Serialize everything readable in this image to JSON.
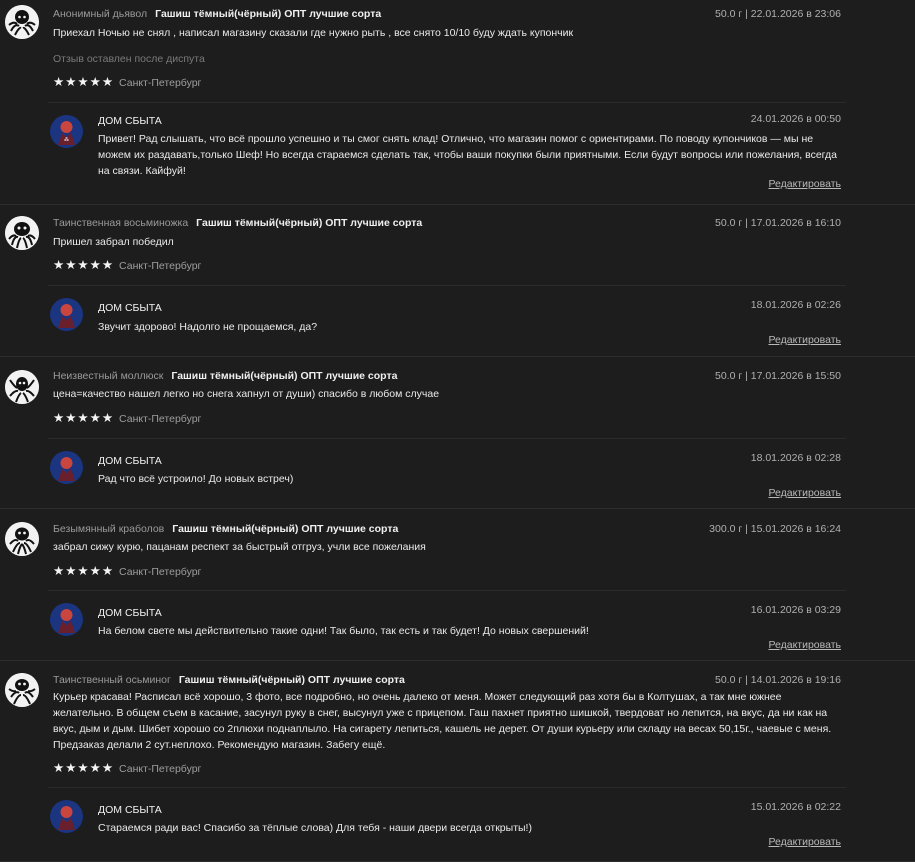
{
  "reviews": [
    {
      "author": "Анонимный дьявол",
      "product": "Гашиш тёмный(чёрный) ОПТ лучшие сорта",
      "meta": "50.0 г | 22.01.2026 в 23:06",
      "text": "Приехал Ночью не снял , написал магазину сказали где нужно рыть , все снято 10/10 буду ждать купончик",
      "note": "Отзыв оставлен после диспута",
      "stars": "★★★★★",
      "rating_value": 5,
      "city": "Санкт-Петербург",
      "reply": {
        "shop": "ДОМ СБЫТА",
        "date": "24.01.2026 в 00:50",
        "text": "Привет! Рад слышать, что всё прошло успешно и ты смог снять клад! Отлично, что магазин помог с ориентирами. По поводу купончиков — мы не можем их раздавать,только Шеф! Но всегда стараемся сделать так, чтобы ваши покупки были приятными. Если будут вопросы или пожелания, всегда на связи. Кайфуй!",
        "edit": "Редактировать"
      }
    },
    {
      "author": "Таинственная восьминожка",
      "product": "Гашиш тёмный(чёрный) ОПТ лучшие сорта",
      "meta": "50.0 г | 17.01.2026 в 16:10",
      "text": "Пришел забрал победил",
      "stars": "★★★★★",
      "rating_value": 5,
      "city": "Санкт-Петербург",
      "reply": {
        "shop": "ДОМ СБЫТА",
        "date": "18.01.2026 в 02:26",
        "text": "Звучит здорово! Надолго не прощаемся, да?",
        "edit": "Редактировать"
      }
    },
    {
      "author": "Неизвестный моллюск",
      "product": "Гашиш тёмный(чёрный) ОПТ лучшие сорта",
      "meta": "50.0 г | 17.01.2026 в 15:50",
      "text": "цена=качество нашел легко но снега хапнул от души) спасибо в любом случае",
      "stars": "★★★★★",
      "rating_value": 5,
      "city": "Санкт-Петербург",
      "reply": {
        "shop": "ДОМ СБЫТА",
        "date": "18.01.2026 в 02:28",
        "text": "Рад что всё устроило! До новых встреч)",
        "edit": "Редактировать"
      }
    },
    {
      "author": "Безымянный краболов",
      "product": "Гашиш тёмный(чёрный) ОПТ лучшие сорта",
      "meta": "300.0 г | 15.01.2026 в 16:24",
      "text": "забрал сижу курю, пацанам респект за быстрый отгруз, учли все пожелания",
      "stars": "★★★★★",
      "rating_value": 5,
      "city": "Санкт-Петербург",
      "reply": {
        "shop": "ДОМ СБЫТА",
        "date": "16.01.2026 в 03:29",
        "text": "На белом свете мы действительно такие одни! Так было, так есть и так будет! До новых свершений!",
        "edit": "Редактировать"
      }
    },
    {
      "author": "Таинственный осьминог",
      "product": "Гашиш тёмный(чёрный) ОПТ лучшие сорта",
      "meta": "50.0 г | 14.01.2026 в 19:16",
      "text": "Курьер красава! Расписал всё хорошо, 3 фото, все подробно, но очень далеко от меня. Может следующий раз хотя бы в Колтушах, а так мне южнее желательно. В общем съем в касание, засунул руку в снег, высунул уже с прицепом. Гаш пахнет приятно шишкой, твердоват но лепится, на вкус, да ни как на вкус, дым и дым. Шибет хорошо со 2плюхи поднаплыло. На сигарету лепиться, кашель не дерет. От души курьеру или складу на весах 50,15г., чаевые с меня. Предзаказ делали 2 сут.неплохо. Рекомендую магазин. Забегу ещё.",
      "stars": "★★★★★",
      "rating_value": 5,
      "city": "Санкт-Петербург",
      "reply": {
        "shop": "ДОМ СБЫТА",
        "date": "15.01.2026 в 02:22",
        "text": "Стараемся ради вас! Спасибо за тёплые слова) Для тебя - наши двери всегда открыты!)",
        "edit": "Редактировать"
      }
    }
  ]
}
